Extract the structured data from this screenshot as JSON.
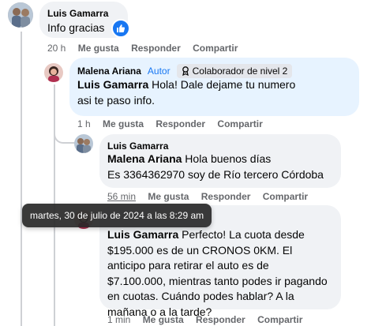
{
  "comments": [
    {
      "author": "Luis Gamarra",
      "text": "Info gracias",
      "time": "20 h",
      "like": "Me gusta",
      "reply": "Responder",
      "share": "Compartir"
    },
    {
      "author": "Malena Ariana",
      "author_badge": "Autor",
      "contributor_badge": "Colaborador de nivel 2",
      "mention": "Luis Gamarra",
      "text": "Hola! Dale dejame tu numero asi te paso info.",
      "time": "1 h",
      "like": "Me gusta",
      "reply": "Responder",
      "share": "Compartir"
    },
    {
      "author": "Luis Gamarra",
      "mention": "Malena Ariana",
      "line1": "Hola buenos días",
      "line2": "Es 3364362970 soy de Río tercero Córdoba",
      "time": "56 min",
      "like": "Me gusta",
      "reply": "Responder",
      "share": "Compartir"
    },
    {
      "mention": "Luis Gamarra",
      "text": "Perfecto! La cuota desde $195.000 es de un CRONOS 0KM. El anticipo para retirar el auto es de $7.100.000, mientras tanto podes ir pagando en cuotas. Cuándo podes hablar? A la mañana o a la tarde?",
      "time": "1 min",
      "like": "Me gusta",
      "reply": "Responder",
      "share": "Compartir"
    }
  ],
  "tooltip": "martes, 30 de julio de 2024 a las 8:29 am",
  "colors": {
    "accent": "#1877f2",
    "bubble_gray": "#f0f2f5",
    "bubble_blue": "#e7f3ff",
    "meta": "#65676b"
  }
}
